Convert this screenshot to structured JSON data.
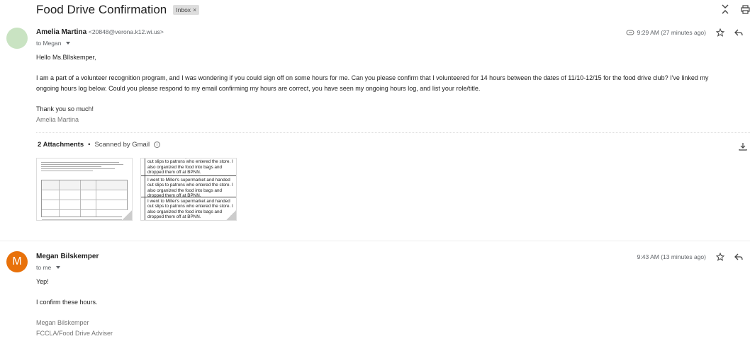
{
  "subject": "Food Drive Confirmation",
  "label": "Inbox",
  "label_close": "×",
  "messages": [
    {
      "sender_name": "Amelia Martina",
      "sender_email": "<20848@verona.k12.wi.us>",
      "to": "to Megan",
      "time": "9:29 AM (27 minutes ago)",
      "greeting": "Hello Ms.BIlskemper,",
      "paragraph1": "I am a part of a volunteer recognition program, and I was wondering if you could sign off on some hours for me. Can you please confirm that I volunteered for 14 hours between the dates of 11/10-12/15 for the food drive club? I've linked my",
      "paragraph2": "ongoing hours log below. Could you please respond to my email confirming my hours are correct, you have seen my ongoing hours log, and list your role/title.",
      "closing": "Thank you so much!",
      "signature": "Amelia Martina"
    },
    {
      "avatar_letter": "M",
      "sender_name": "Megan Bilskemper",
      "to": "to me",
      "time": "9:43 AM (13 minutes ago)",
      "line1": "Yep!",
      "line2": "I confirm these hours.",
      "sig_name": "Megan Bilskemper",
      "sig_title": "FCCLA/Food Drive Adviser"
    }
  ],
  "attachments": {
    "count_label": "2 Attachments",
    "separator": "•",
    "scanned": "Scanned by Gmail",
    "thumb2_rows": [
      "I went to Miller's supermarket and handed out slips to patrons who entered the store. I also organized the food into bags and dropped them off at BPNN.",
      "I went to Miller's supermarket and handed out slips to patrons who entered the store. I also organized the food into bags and dropped them off at BPNN.",
      "I went to Miller's supermarket and handed out slips to patrons who entered the store. I also organized the food into bags and dropped them off at BPNN."
    ]
  },
  "icons": {
    "collapse": "collapse-icon",
    "print": "print-icon",
    "attachment": "paperclip-icon",
    "star": "star-icon",
    "reply": "reply-icon",
    "download": "download-icon",
    "info": "info-icon"
  }
}
